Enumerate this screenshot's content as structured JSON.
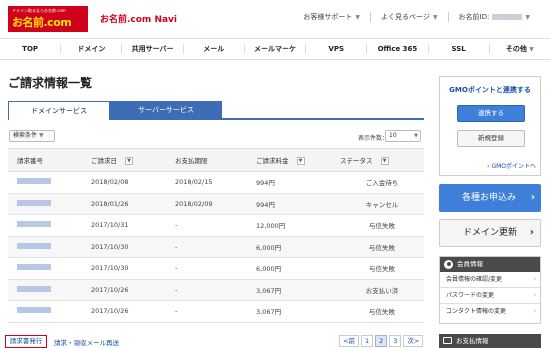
{
  "header": {
    "logo_small": "ドメイン取るならお名前.com",
    "logo_main": "お名前.com",
    "app_name": "お名前.com Navi",
    "support_label": "お客様サポート",
    "faq_label": "よく見るページ",
    "user_id_label": "お名前ID:"
  },
  "nav": {
    "items": [
      "TOP",
      "ドメイン",
      "共用サーバー",
      "メール",
      "メールマーケ",
      "VPS",
      "Office 365",
      "SSL",
      "その他"
    ]
  },
  "page": {
    "title": "ご請求情報一覧"
  },
  "tabs": {
    "domain": "ドメインサービス",
    "server": "サーバーサービス"
  },
  "filter": {
    "label": "検索条件",
    "per_page_label": "表示件数：",
    "per_page_value": "10"
  },
  "table": {
    "headers": {
      "invoice_no": "請求番号",
      "invoice_date": "ご請求日",
      "due_date": "お支払期限",
      "amount": "ご請求料金",
      "status": "ステータス"
    },
    "rows": [
      {
        "date": "2018/02/08",
        "due": "2018/02/15",
        "amount": "994円",
        "status": "ご入金待ち"
      },
      {
        "date": "2018/01/26",
        "due": "2018/02/09",
        "amount": "994円",
        "status": "キャンセル"
      },
      {
        "date": "2017/10/31",
        "due": "-",
        "amount": "12,000円",
        "status": "与信失敗"
      },
      {
        "date": "2017/10/30",
        "due": "-",
        "amount": "6,000円",
        "status": "与信失敗"
      },
      {
        "date": "2017/10/30",
        "due": "-",
        "amount": "6,000円",
        "status": "与信失敗"
      },
      {
        "date": "2017/10/26",
        "due": "-",
        "amount": "3,067円",
        "status": "お支払い済"
      },
      {
        "date": "2017/10/26",
        "due": "-",
        "amount": "3,067円",
        "status": "与信失敗"
      }
    ]
  },
  "footer": {
    "issue_button": "請求書発行",
    "resend_link": "請求・領収メール再送",
    "prev": "<前",
    "pages": [
      "1",
      "2",
      "3"
    ],
    "next": "次>"
  },
  "sidebar": {
    "gmo_title": "GMOポイントと連携する",
    "gmo_link_button": "連携する",
    "gmo_register_button": "新規登録",
    "gmo_point_link": "› GMOポイントへ",
    "apply_button": "各種お申込み",
    "renew_button": "ドメイン更新",
    "member_header": "会員情報",
    "member_links": [
      "会員情報の確認/変更",
      "パスワードの変更",
      "コンタクト情報の変更"
    ],
    "payment_header": "お支払情報"
  },
  "colors": {
    "brand_red": "#d0021b",
    "accent_blue": "#3d7fd9",
    "tab_blue": "#3d6db5"
  }
}
